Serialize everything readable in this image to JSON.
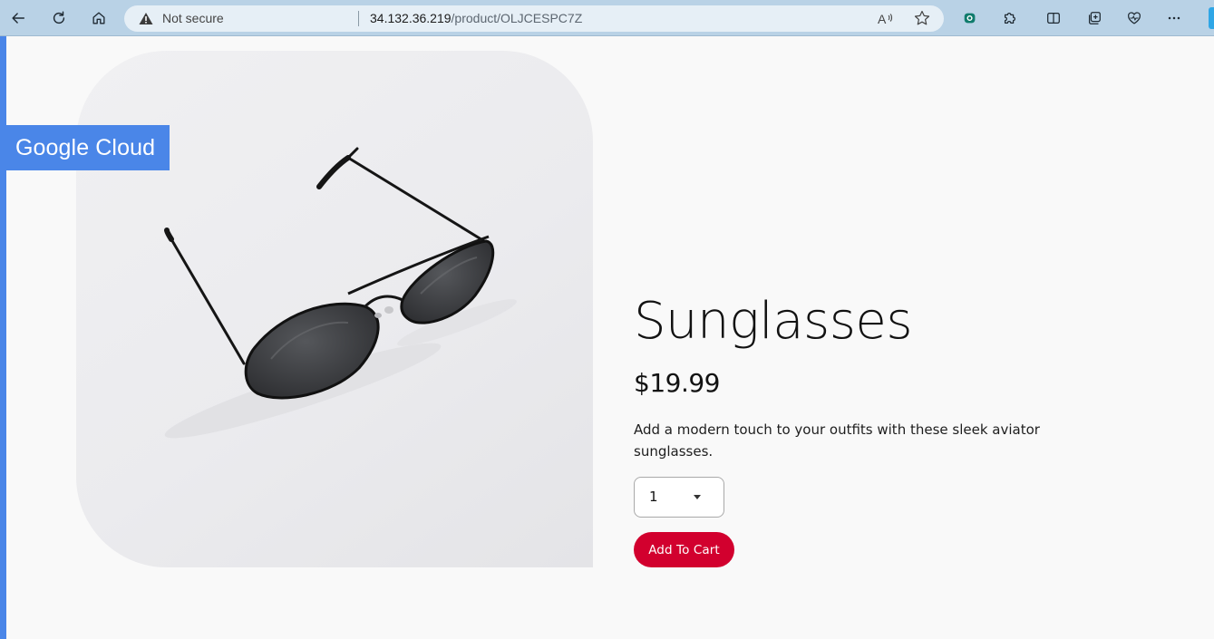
{
  "browser": {
    "security_label": "Not secure",
    "url_host": "34.132.36.219",
    "url_path": "/product/OLJCESPC7Z",
    "icons": [
      "back-icon",
      "refresh-icon",
      "home-icon",
      "warning-icon",
      "read-aloud-icon",
      "favorite-star-icon",
      "extension-badge-icon",
      "extensions-puzzle-icon",
      "split-screen-icon",
      "collections-icon",
      "browser-essentials-icon",
      "more-menu-icon"
    ]
  },
  "badge": {
    "label": "Google Cloud"
  },
  "product": {
    "title": "Sunglasses",
    "price": "$19.99",
    "description": "Add a modern touch to your outfits with these sleek aviator sunglasses.",
    "quantity": "1",
    "add_to_cart_label": "Add To Cart"
  },
  "colors": {
    "accent_blue": "#4a86e8",
    "cart_button": "#d2002e",
    "toolbar": "#b9d2e6"
  }
}
